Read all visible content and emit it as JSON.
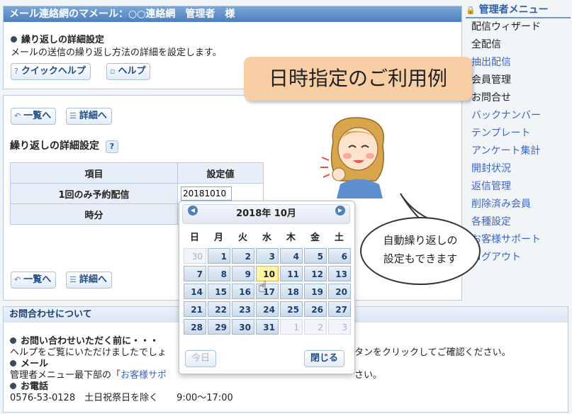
{
  "top_panel": {
    "header": "メール連絡網のマメール：○○連絡網　管理者　様",
    "section_title": "繰り返しの詳細設定",
    "description": "メールの送信の繰り返し方法の詳細を設定します。",
    "quick_help_label": "クイックヘルプ",
    "help_label": "ヘルプ"
  },
  "main_panel": {
    "list_label": "一覧へ",
    "detail_label": "詳細へ",
    "title": "繰り返しの詳細設定",
    "help_mark": "?",
    "table": {
      "col_item": "項目",
      "col_value": "設定値",
      "rows": [
        {
          "label": "1回のみ予約配信",
          "value": "20181010"
        },
        {
          "label": "時分",
          "value": ""
        }
      ]
    }
  },
  "calendar": {
    "title": "2018年 10月",
    "weekdays": [
      "日",
      "月",
      "火",
      "水",
      "木",
      "金",
      "土"
    ],
    "weeks": [
      [
        "30",
        "1",
        "2",
        "3",
        "4",
        "5",
        "6"
      ],
      [
        "7",
        "8",
        "9",
        "10",
        "11",
        "12",
        "13"
      ],
      [
        "14",
        "15",
        "16",
        "17",
        "18",
        "19",
        "20"
      ],
      [
        "21",
        "22",
        "23",
        "24",
        "25",
        "26",
        "27"
      ],
      [
        "28",
        "29",
        "30",
        "31",
        "1",
        "2",
        "3"
      ]
    ],
    "today_label": "今日",
    "close_label": "閉じる",
    "selected": "10"
  },
  "contact": {
    "header": "お問合わせについて",
    "before_title": "お問い合わせいただく前に・・・",
    "before_text": "ヘルプをご覧にいただけましたでしょ",
    "before_text_tail": "タンをクリックしてご確認ください。",
    "mail_title": "メール",
    "mail_text_pre": "管理者メニュー最下部の「",
    "mail_link": "お客様サポ",
    "mail_text_tail": "さい。",
    "phone_title": "お電話",
    "phone_text": "0576-53-0128　土日祝祭日を除く　　9:00～17:00"
  },
  "sidebar": {
    "title": "管理者メニュー",
    "items": [
      {
        "label": "配信ウィザード",
        "current": true
      },
      {
        "label": "全配信",
        "current": true
      },
      {
        "label": "抽出配信",
        "current": false
      },
      {
        "label": "会員管理",
        "current": true
      },
      {
        "label": "お問合せ",
        "current": true
      },
      {
        "label": "バックナンバー",
        "current": false
      },
      {
        "label": "テンプレート",
        "current": false
      },
      {
        "label": "アンケート集計",
        "current": false
      },
      {
        "label": "開封状況",
        "current": false
      },
      {
        "label": "返信管理",
        "current": false
      },
      {
        "label": "削除済み会員",
        "current": false
      },
      {
        "label": "各種設定",
        "current": false
      },
      {
        "label": "お客様サポート",
        "current": false
      },
      {
        "label": "ログアウト",
        "current": false
      }
    ]
  },
  "overlay": {
    "banner": "日時指定のご利用例",
    "bubble_line1": "自動繰り返しの",
    "bubble_line2": "設定もできます"
  },
  "colors": {
    "accent": "#4d7fbf",
    "banner": "#f8cfa5",
    "selected_day": "#fff3a6"
  }
}
